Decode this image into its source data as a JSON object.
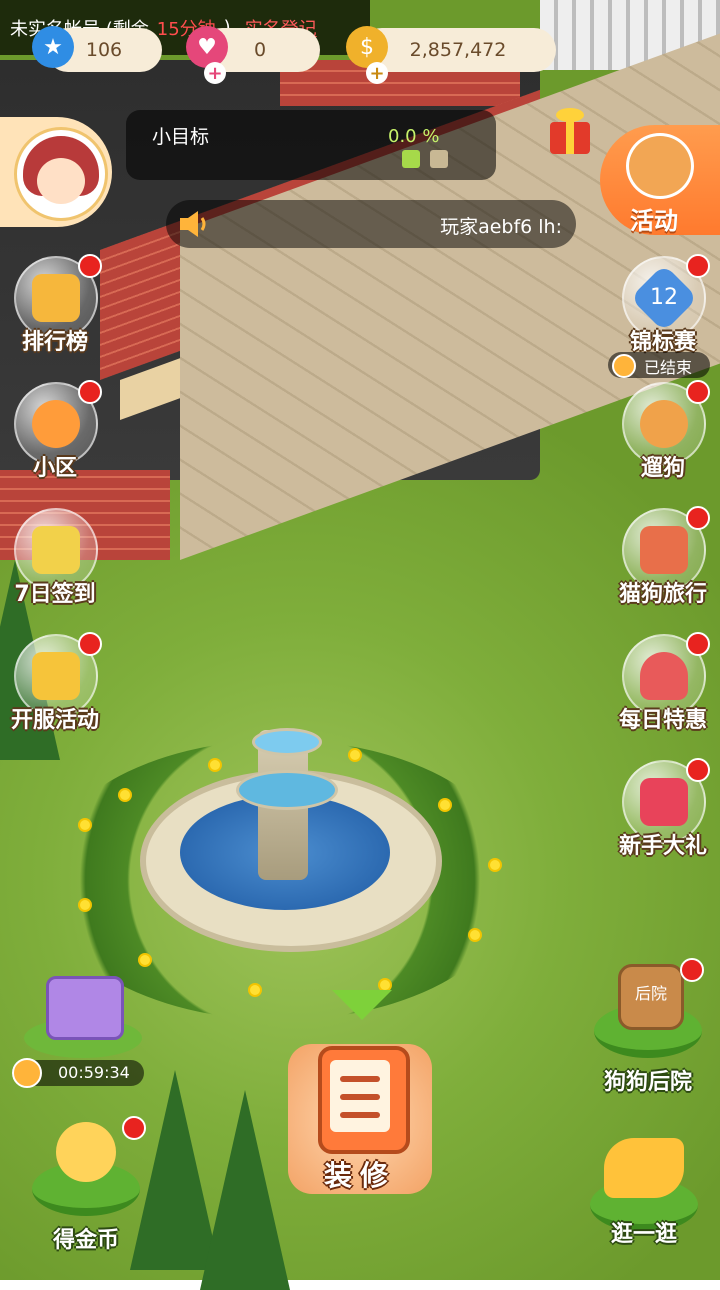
{
  "status_bar": {
    "account_text": "未实名帐号 (剩余",
    "time_left": "15分钟",
    "close_paren": ")",
    "realname_link": "实名登记"
  },
  "currencies": [
    {
      "icon": "star-icon",
      "value": "106",
      "color": "#2f8de4"
    },
    {
      "icon": "heart-icon",
      "value": "0",
      "color": "#e5477a"
    },
    {
      "icon": "coin-icon",
      "value": "2,857,472",
      "color": "#f0b12b"
    }
  ],
  "goal": {
    "label": "小目标",
    "percent": "0.0 %",
    "progress": 0.0
  },
  "chat": {
    "message": "玩家aebf6 lh:"
  },
  "left_menu": [
    {
      "label": "排行榜",
      "icon": "trophy-podium-icon",
      "badge": true,
      "color": "#f6b73c"
    },
    {
      "label": "小区",
      "icon": "community-icon",
      "badge": true,
      "color": "#ff9c3a"
    },
    {
      "label": "7日签到",
      "icon": "calendar-icon",
      "badge": false,
      "color": "#f2d14a"
    },
    {
      "label": "开服活动",
      "icon": "crown-icon",
      "badge": true,
      "color": "#f6c43a"
    }
  ],
  "right_menu": {
    "activity_label": "活动",
    "items": [
      {
        "label": "锦标赛",
        "icon": "tournament-badge-icon",
        "badge": true,
        "color": "#4a8fe0",
        "number": "12"
      },
      {
        "label": "遛狗",
        "icon": "walk-dog-icon",
        "badge": true,
        "color": "#f0a24a"
      },
      {
        "label": "猫狗旅行",
        "icon": "travel-photo-icon",
        "badge": true,
        "color": "#e86f4a"
      },
      {
        "label": "每日特惠",
        "icon": "shop-icon",
        "badge": true,
        "color": "#e85a5a"
      },
      {
        "label": "新手大礼",
        "icon": "gift-pack-icon",
        "badge": true,
        "color": "#e8435a"
      }
    ]
  },
  "tournament_status": "已结束",
  "chest_timer": "00:59:34",
  "bottom": {
    "coins_label": "得金币",
    "decorate_label": "装修",
    "backyard_label": "狗狗后院",
    "backyard_sign": "后院",
    "stroll_label": "逛一逛"
  }
}
